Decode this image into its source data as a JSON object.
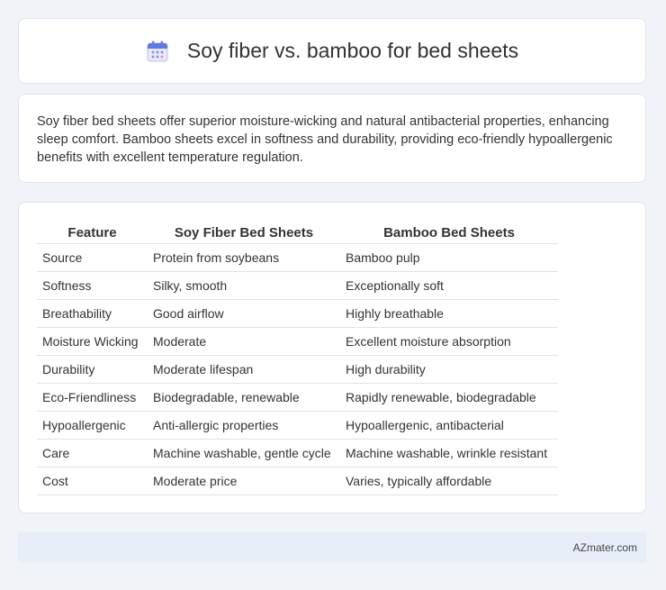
{
  "header": {
    "title": "Soy fiber vs. bamboo for bed sheets",
    "icon": "calendar-icon"
  },
  "summary": {
    "text": "Soy fiber bed sheets offer superior moisture-wicking and natural antibacterial properties, enhancing sleep comfort. Bamboo sheets excel in softness and durability, providing eco-friendly hypoallergenic benefits with excellent temperature regulation."
  },
  "table": {
    "headers": [
      "Feature",
      "Soy Fiber Bed Sheets",
      "Bamboo Bed Sheets"
    ],
    "rows": [
      [
        "Source",
        "Protein from soybeans",
        "Bamboo pulp"
      ],
      [
        "Softness",
        "Silky, smooth",
        "Exceptionally soft"
      ],
      [
        "Breathability",
        "Good airflow",
        "Highly breathable"
      ],
      [
        "Moisture Wicking",
        "Moderate",
        "Excellent moisture absorption"
      ],
      [
        "Durability",
        "Moderate lifespan",
        "High durability"
      ],
      [
        "Eco-Friendliness",
        "Biodegradable, renewable",
        "Rapidly renewable, biodegradable"
      ],
      [
        "Hypoallergenic",
        "Anti-allergic properties",
        "Hypoallergenic, antibacterial"
      ],
      [
        "Care",
        "Machine washable, gentle cycle",
        "Machine washable, wrinkle resistant"
      ],
      [
        "Cost",
        "Moderate price",
        "Varies, typically affordable"
      ]
    ]
  },
  "footer": {
    "brand": "AZmater.com"
  }
}
